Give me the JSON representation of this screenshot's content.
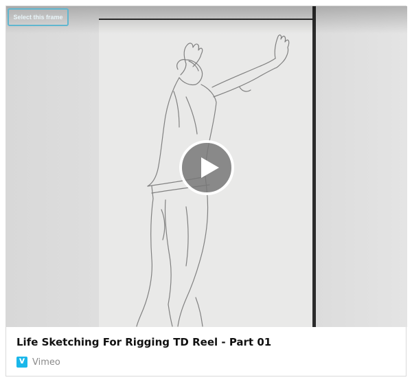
{
  "frame": {
    "select_label": "Select this frame"
  },
  "video": {
    "title": "Life Sketching For Rigging TD Reel - Part 01",
    "source": "Vimeo",
    "source_icon": "vimeo-icon",
    "play_icon": "play-icon"
  },
  "colors": {
    "accent": "#5fb6cf",
    "vimeo_brand": "#1ab7ea"
  }
}
